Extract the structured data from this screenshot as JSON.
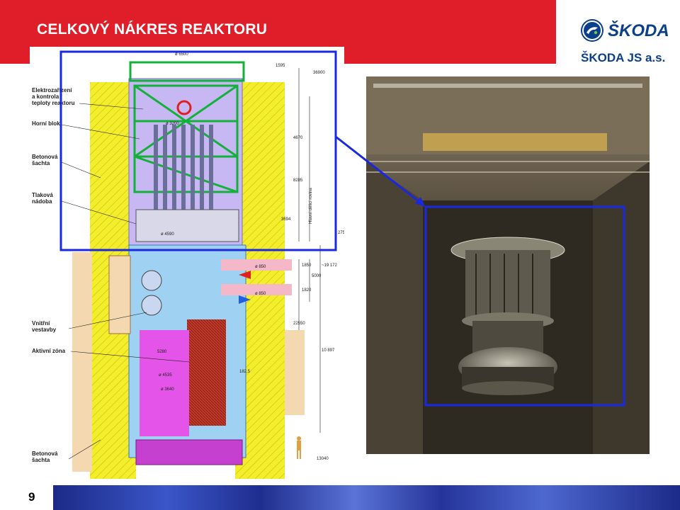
{
  "slide": {
    "title": "CELKOVÝ NÁKRES REAKTORU",
    "page_number": "9"
  },
  "brand": {
    "logo_text": "ŠKODA",
    "company": "ŠKODA JS a.s."
  },
  "drawing": {
    "labels": {
      "electro": "Elektrozařízení",
      "electro2": "a kontrola",
      "electro3": "teploty reaktoru",
      "upper_block": "Horní blok",
      "concrete_shaft": "Betonová",
      "concrete_shaft2": "šachta",
      "pressure_vessel": "Tlaková",
      "pressure_vessel2": "nádoba",
      "internals": "Vnitřní",
      "internals2": "vestavby",
      "active_zone": "Aktivní zóna",
      "concrete_shaft_b": "Betonová",
      "concrete_shaft_b2": "šachta"
    },
    "dimensions": {
      "top_width": "ø 6500",
      "d1": "1595",
      "d2": "36900",
      "d3": "4670",
      "d4": "8285",
      "d5": "3694",
      "d6": "Hlavní dělicí rovina",
      "d7": "275",
      "d8": "ø 3200",
      "d9": "ø 4590",
      "d10": "ø 850",
      "d11": "1850",
      "d12": "1820",
      "d13": "5000",
      "d14": "~19 172",
      "d15": "22550",
      "d16": "10 897",
      "d17": "5280",
      "d18": "ø 4535",
      "d19": "ø 3640",
      "d20": "182,5",
      "d21": "13040",
      "d22": "ø 850"
    }
  },
  "colors": {
    "title_bar": "#e01e2a",
    "brand_blue": "#0b3f8a",
    "highlight_box": "#1a28e0"
  }
}
